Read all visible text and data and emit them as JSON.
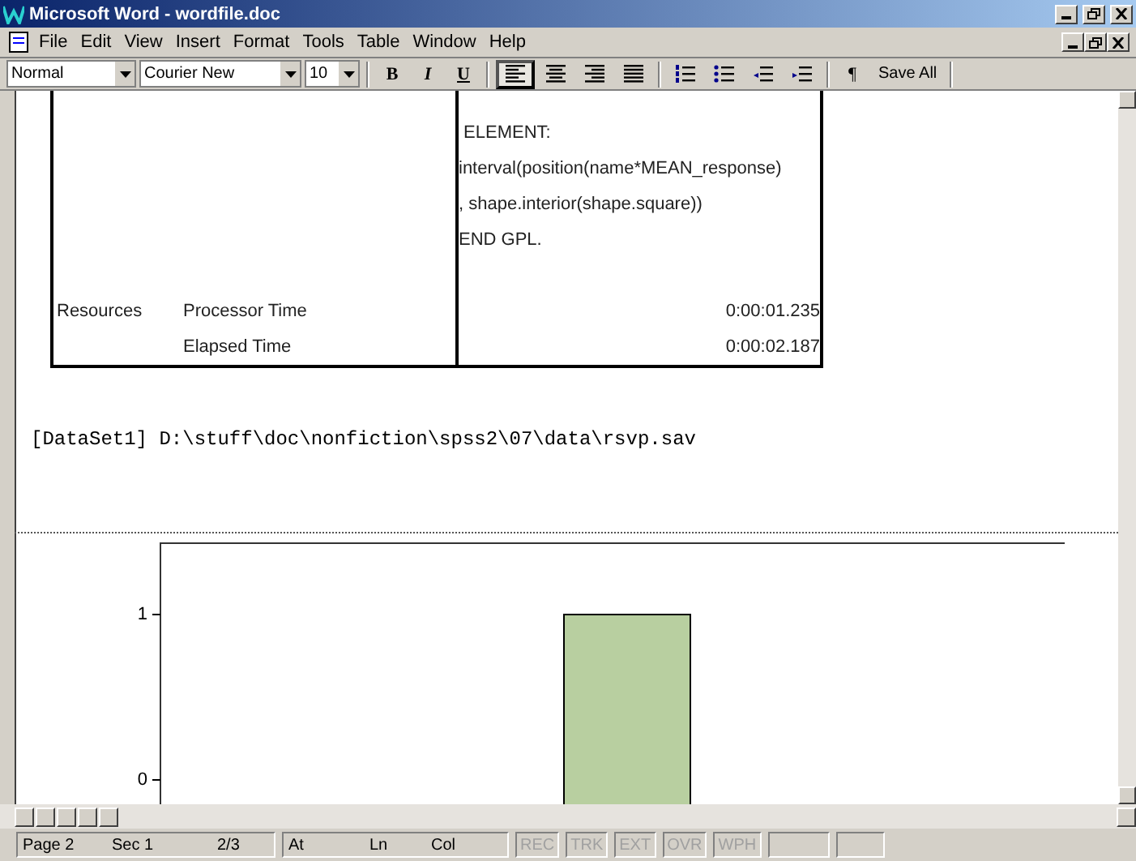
{
  "window": {
    "title": "Microsoft Word - wordfile.doc"
  },
  "menu": [
    "File",
    "Edit",
    "View",
    "Insert",
    "Format",
    "Tools",
    "Table",
    "Window",
    "Help"
  ],
  "toolbar": {
    "style": "Normal",
    "font": "Courier New",
    "size": "10",
    "formatting": [
      {
        "kind": "bold",
        "label": "B"
      },
      {
        "kind": "italic",
        "label": "I"
      },
      {
        "kind": "underline",
        "label": "U"
      }
    ],
    "alignment": [
      {
        "kind": "left",
        "selected": true
      },
      {
        "kind": "center",
        "selected": false
      },
      {
        "kind": "right",
        "selected": false
      },
      {
        "kind": "justify",
        "selected": false
      }
    ],
    "lists": [
      {
        "kind": "numbering"
      },
      {
        "kind": "bullets"
      },
      {
        "kind": "outdent"
      },
      {
        "kind": "indent"
      }
    ],
    "pilcrow": "¶",
    "save_all": "Save All"
  },
  "document": {
    "table": {
      "rows": [
        {
          "column_3": " ELEMENT:"
        },
        {
          "column_3": "interval(position(name*MEAN_response)"
        },
        {
          "column_3": ", shape.interior(shape.square))"
        },
        {
          "column_3": "END GPL."
        },
        {},
        {
          "column_1": "Resources",
          "column_2": "Processor Time",
          "column_3": "0:00:01.235",
          "numeric": true
        },
        {
          "column_2": "Elapsed Time",
          "column_3": "0:00:02.187",
          "numeric": true
        }
      ]
    },
    "dataset_line": "[DataSet1] D:\\stuff\\doc\\nonfiction\\spss2\\07\\data\\rsvp.sav",
    "chart": {
      "y_axis_labels": [
        "1",
        "0"
      ]
    }
  },
  "status_bar": {
    "page": "Page 2",
    "section": "Sec 1",
    "pages": "2/3",
    "at": "At",
    "line": "Ln",
    "column": "Col",
    "modes": [
      {
        "label": "REC",
        "disabled": true
      },
      {
        "label": "TRK",
        "disabled": true
      },
      {
        "label": "EXT",
        "disabled": true
      },
      {
        "label": "OVR",
        "disabled": true
      },
      {
        "label": "WPH",
        "disabled": true
      }
    ]
  }
}
